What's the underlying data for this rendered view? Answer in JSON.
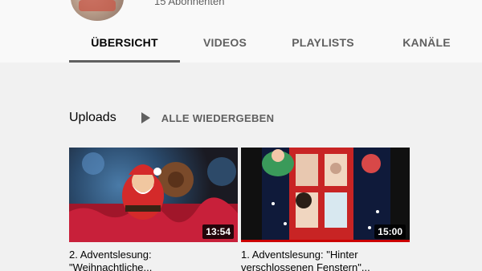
{
  "channel": {
    "subscribers": "15 Abonnenten"
  },
  "tabs": [
    {
      "label": "ÜBERSICHT",
      "active": true
    },
    {
      "label": "VIDEOS",
      "active": false
    },
    {
      "label": "PLAYLISTS",
      "active": false
    },
    {
      "label": "KANÄLE",
      "active": false
    }
  ],
  "shelf": {
    "title": "Uploads",
    "play_all": "ALLE WIEDERGEBEN",
    "play_icon": "play-icon"
  },
  "videos": [
    {
      "title_line1": "2. Adventslesung:",
      "title_line2": "\"Weihnachtliche...",
      "duration": "13:54"
    },
    {
      "title_line1": "1. Adventslesung: \"Hinter",
      "title_line2": "verschlossenen Fenstern\"...",
      "duration": "15:00",
      "watched": 1.0
    }
  ],
  "colors": {
    "accent": "#606060",
    "progress": "#cc0000",
    "background": "#f1f1f1",
    "header": "#f9f9f9"
  }
}
